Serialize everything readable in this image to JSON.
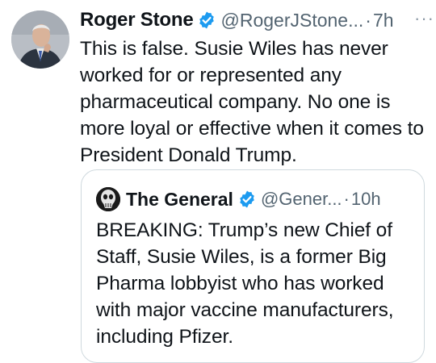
{
  "tweet": {
    "author_name": "Roger Stone",
    "author_handle": "@RogerJStone...",
    "separator": "·",
    "time": "7h",
    "more_label": "···",
    "text": "This is false. Susie Wiles has never worked for or represented any pharmaceutical company. No one is more loyal or effective when it comes to President Donald Trump."
  },
  "quote": {
    "author_name": "The General",
    "author_handle": "@Gener...",
    "separator": "·",
    "time": "10h",
    "text": "BREAKING: Trump’s new Chief of Staff, Susie Wiles, is a former Big Pharma lobbyist who has worked with major vaccine manufacturers, including Pfizer."
  },
  "colors": {
    "verified": "#1d9bf0",
    "secondary_text": "#536471",
    "border": "#cfd9de"
  },
  "icons": {
    "verified": "verified-badge-icon",
    "more": "more-options-icon"
  }
}
